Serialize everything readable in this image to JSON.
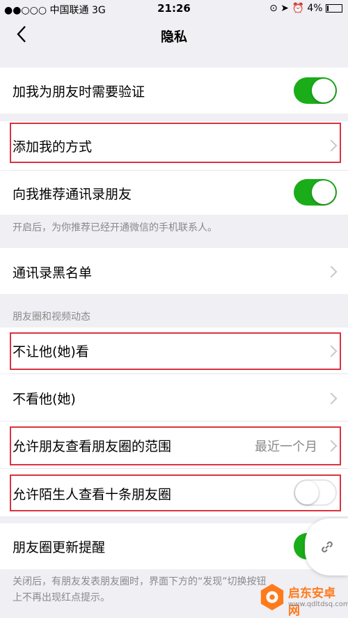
{
  "status_bar": {
    "carrier": "●●○○○ 中国联通   3G",
    "time": "21:26",
    "right": "4%"
  },
  "nav": {
    "title": "隐私"
  },
  "rows": {
    "verify": {
      "label": "加我为朋友时需要验证",
      "toggle": true
    },
    "add_methods": {
      "label": "添加我的方式"
    },
    "recommend": {
      "label": "向我推荐通讯录朋友",
      "toggle": true
    },
    "recommend_hint": "开启后，为你推荐已经开通微信的手机联系人。",
    "blacklist": {
      "label": "通讯录黑名单"
    },
    "moments_header": "朋友圈和视频动态",
    "hide_from": {
      "label": "不让他(她)看"
    },
    "not_see": {
      "label": "不看他(她)"
    },
    "range": {
      "label": "允许朋友查看朋友圈的范围",
      "value": "最近一个月"
    },
    "stranger": {
      "label": "允许陌生人查看十条朋友圈",
      "toggle": false
    },
    "update_remind": {
      "label": "朋友圈更新提醒",
      "toggle": true
    },
    "update_hint_1": "关闭后，有朋友发表朋友圈时，界面下方的“发现”切换按钮",
    "update_hint_2": "上不再出现红点提示。"
  },
  "watermark": {
    "brand": "启东安卓网",
    "url": "www.qdltdsq.com"
  },
  "colors": {
    "toggle_on": "#1aad19",
    "highlight": "#d9333f",
    "background": "#efeff4"
  }
}
